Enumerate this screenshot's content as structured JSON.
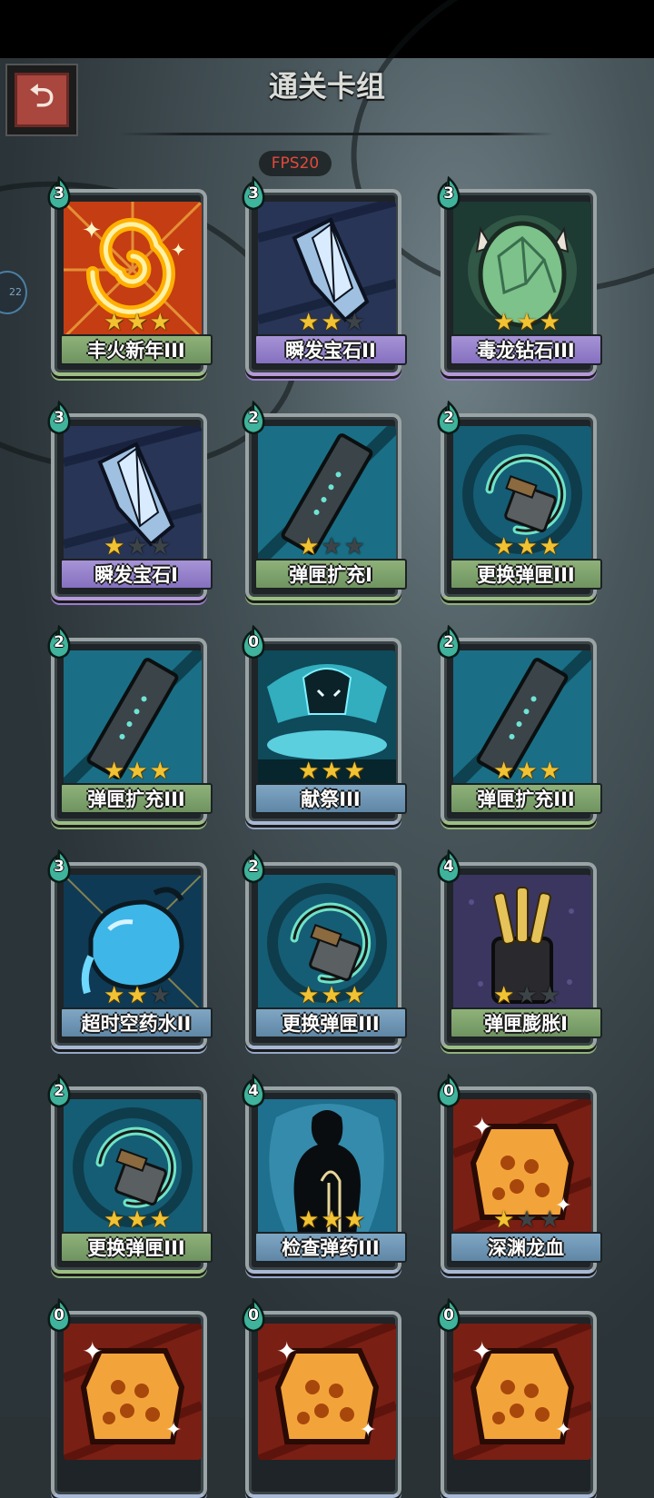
{
  "header": {
    "title": "通关卡组",
    "fps": "FPS20",
    "side_indicator": "22"
  },
  "cards": [
    {
      "name": "丰火新年III",
      "cost": "3",
      "stars": 3,
      "rarity": "green",
      "art": "fire-swirl-icon"
    },
    {
      "name": "瞬发宝石II",
      "cost": "3",
      "stars": 2,
      "rarity": "purple",
      "art": "crystal-gem-icon"
    },
    {
      "name": "毒龙钻石III",
      "cost": "3",
      "stars": 3,
      "rarity": "purple",
      "art": "dragon-egg-icon"
    },
    {
      "name": "瞬发宝石I",
      "cost": "3",
      "stars": 1,
      "rarity": "purple",
      "art": "crystal-gem-icon"
    },
    {
      "name": "弹匣扩充I",
      "cost": "2",
      "stars": 1,
      "rarity": "green",
      "art": "ammo-clip-icon"
    },
    {
      "name": "更换弹匣III",
      "cost": "2",
      "stars": 3,
      "rarity": "green",
      "art": "reload-magazine-icon"
    },
    {
      "name": "弹匣扩充III",
      "cost": "2",
      "stars": 3,
      "rarity": "green",
      "art": "ammo-clip-icon"
    },
    {
      "name": "献祭III",
      "cost": "0",
      "stars": 3,
      "rarity": "blue",
      "art": "sacrifice-spirit-icon"
    },
    {
      "name": "弹匣扩充III",
      "cost": "2",
      "stars": 3,
      "rarity": "green",
      "art": "ammo-clip-icon"
    },
    {
      "name": "超时空药水II",
      "cost": "3",
      "stars": 2,
      "rarity": "blue",
      "art": "potion-jug-icon"
    },
    {
      "name": "更换弹匣III",
      "cost": "2",
      "stars": 3,
      "rarity": "blue",
      "art": "reload-magazine-icon"
    },
    {
      "name": "弹匣膨胀I",
      "cost": "4",
      "stars": 1,
      "rarity": "green",
      "art": "bullet-bundle-icon"
    },
    {
      "name": "更换弹匣III",
      "cost": "2",
      "stars": 3,
      "rarity": "green",
      "art": "reload-magazine-icon"
    },
    {
      "name": "检查弹药III",
      "cost": "4",
      "stars": 3,
      "rarity": "blue",
      "art": "shadow-gunner-icon"
    },
    {
      "name": "深渊龙血",
      "cost": "0",
      "stars": 1,
      "rarity": "blue",
      "art": "dragon-blood-flask-icon"
    },
    {
      "name": "",
      "cost": "0",
      "stars": 0,
      "rarity": "blue",
      "art": "dragon-blood-flask-icon"
    },
    {
      "name": "",
      "cost": "0",
      "stars": 0,
      "rarity": "blue",
      "art": "dragon-blood-flask-icon"
    },
    {
      "name": "",
      "cost": "0",
      "stars": 0,
      "rarity": "blue",
      "art": "dragon-blood-flask-icon"
    }
  ],
  "colors": {
    "rarity_green": "#8fb27a",
    "rarity_purple": "#a793d6",
    "rarity_blue": "#7fa7c4",
    "star_on": "#f1c232",
    "cost_badge": "#3fb39b",
    "fps_text": "#e24a3a"
  }
}
